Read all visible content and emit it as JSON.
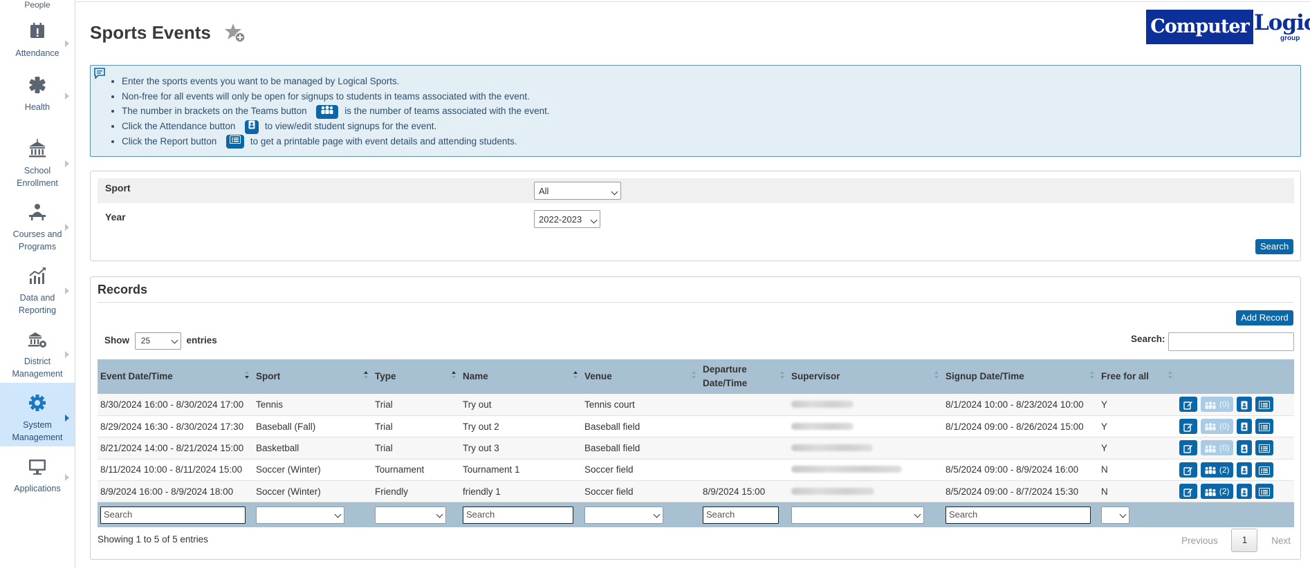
{
  "sidebar": {
    "top_label": "People",
    "items": [
      {
        "label_lines": [
          "Attendance"
        ],
        "icon": "calendar-alert-icon"
      },
      {
        "label_lines": [
          "Health"
        ],
        "icon": "medical-icon"
      },
      {
        "label_lines": [
          "School",
          "Enrollment"
        ],
        "icon": "school-building-icon"
      },
      {
        "label_lines": [
          "Courses and",
          "Programs"
        ],
        "icon": "teacher-desk-icon"
      },
      {
        "label_lines": [
          "Data and",
          "Reporting"
        ],
        "icon": "line-chart-icon"
      },
      {
        "label_lines": [
          "District",
          "Management"
        ],
        "icon": "district-building-icon"
      },
      {
        "label_lines": [
          "System",
          "Management"
        ],
        "icon": "gear-icon",
        "active": true
      },
      {
        "label_lines": [
          "Applications"
        ],
        "icon": "monitor-icon"
      }
    ]
  },
  "header": {
    "title": "Sports Events",
    "logo_left": "Computer",
    "logo_right": "Logic",
    "logo_sub": "group"
  },
  "info": {
    "line1": "Enter the sports events you want to be managed by Logical Sports.",
    "line2": "Non-free for all events will only be open for signups to students in teams associated with the event.",
    "line3_a": "The number in brackets on the Teams button",
    "line3_b": "is the number of teams associated with the event.",
    "line4_a": "Click the Attendance button",
    "line4_b": "to view/edit student signups for the event.",
    "line5_a": "Click the Report button",
    "line5_b": "to get a printable page with event details and attending students."
  },
  "filter": {
    "sport_label": "Sport",
    "sport_value": "All",
    "year_label": "Year",
    "year_value": "2022-2023",
    "search_button": "Search"
  },
  "records": {
    "title": "Records",
    "add_button": "Add Record",
    "show_label": "Show",
    "show_value": "25",
    "entries_label": "entries",
    "search_label": "Search:",
    "columns": {
      "event_datetime": "Event Date/Time",
      "sport": "Sport",
      "type": "Type",
      "name": "Name",
      "venue": "Venue",
      "departure_line1": "Departure",
      "departure_line2": "Date/Time",
      "supervisor": "Supervisor",
      "signup": "Signup Date/Time",
      "free": "Free for all"
    },
    "rows": [
      {
        "event": "8/30/2024 16:00 - 8/30/2024 17:00",
        "sport": "Tennis",
        "type": "Trial",
        "name": "Try out",
        "venue": "Tennis court",
        "departure": "",
        "signup": "8/1/2024 10:00 - 8/23/2024 10:00",
        "free": "Y",
        "teams": "(0)"
      },
      {
        "event": "8/29/2024 16:30 - 8/30/2024 17:30",
        "sport": "Baseball (Fall)",
        "type": "Trial",
        "name": "Try out 2",
        "venue": "Baseball field",
        "departure": "",
        "signup": "8/1/2024 09:00 - 8/26/2024 15:00",
        "free": "Y",
        "teams": "(0)"
      },
      {
        "event": "8/21/2024 14:00 - 8/21/2024 15:00",
        "sport": "Basketball",
        "type": "Trial",
        "name": "Try out 3",
        "venue": "Baseball field",
        "departure": "",
        "signup": "",
        "free": "Y",
        "teams": "(0)"
      },
      {
        "event": "8/11/2024 10:00 - 8/11/2024 15:00",
        "sport": "Soccer (Winter)",
        "type": "Tournament",
        "name": "Tournament 1",
        "venue": "Soccer field",
        "departure": "",
        "signup": "8/5/2024 09:00 - 8/9/2024 16:00",
        "free": "N",
        "teams": "(2)"
      },
      {
        "event": "8/9/2024 16:00 - 8/9/2024 18:00",
        "sport": "Soccer (Winter)",
        "type": "Friendly",
        "name": "friendly 1",
        "venue": "Soccer field",
        "departure": "8/9/2024 15:00",
        "signup": "8/5/2024 09:00 - 8/7/2024 15:30",
        "free": "N",
        "teams": "(2)"
      }
    ],
    "filter_placeholder": "Search",
    "showing": "Showing 1 to 5 of 5 entries",
    "pager": {
      "prev": "Previous",
      "page": "1",
      "next": "Next"
    }
  },
  "colors": {
    "primary": "#0c67a8",
    "table_header": "#a7c1d2",
    "info_bg": "#e4eff5",
    "sidebar_active": "#cfe6fb"
  }
}
